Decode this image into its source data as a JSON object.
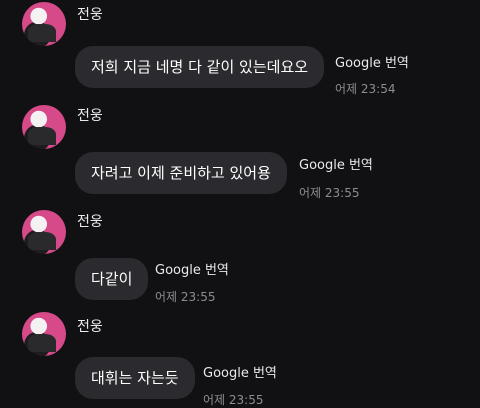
{
  "messages": [
    {
      "sender": "전웅",
      "text": "저희 지금 네명 다 같이 있는데요오",
      "translate": "Google 번역",
      "time": "어제 23:54"
    },
    {
      "sender": "전웅",
      "text": "자려고 이제 준비하고 있어용",
      "translate": "Google 번역",
      "time": "어제 23:55"
    },
    {
      "sender": "전웅",
      "text": "다같이",
      "translate": "Google 번역",
      "time": "어제 23:55"
    },
    {
      "sender": "전웅",
      "text": "대휘는 자는듯",
      "translate": "Google 번역",
      "time": "어제 23:55"
    }
  ]
}
